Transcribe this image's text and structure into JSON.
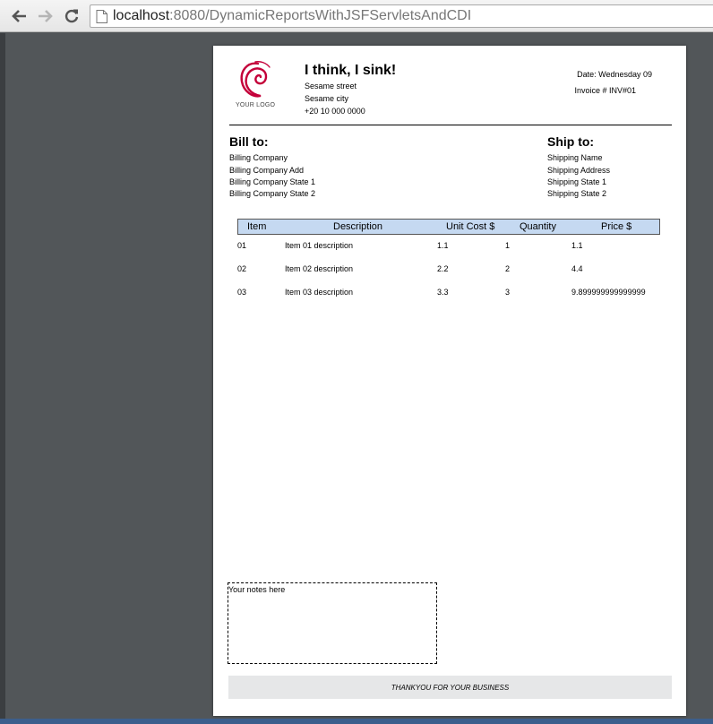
{
  "browser": {
    "url_host": "localhost",
    "url_rest": ":8080/DynamicReportsWithJSFServletsAndCDI"
  },
  "report": {
    "logo_text": "YOUR LOGO",
    "company": {
      "name": "I think, I sink!",
      "street": "Sesame street",
      "city": "Sesame city",
      "phone": "+20 10 000 0000"
    },
    "date_line": "Date: Wednesday 09",
    "invoice_line": "Invoice # INV#01",
    "bill_to": {
      "title": "Bill to:",
      "lines": [
        "Billing Company",
        "Billing Company Add",
        "Billing Company State 1",
        "Billing Company State 2"
      ]
    },
    "ship_to": {
      "title": "Ship to:",
      "lines": [
        "Shipping Name",
        "Shipping Address",
        "Shipping State 1",
        "Shipping State 2"
      ]
    },
    "table": {
      "headers": [
        "Item",
        "Description",
        "Unit Cost $",
        "Quantity",
        "Price $"
      ],
      "rows": [
        [
          "01",
          "Item 01 description",
          "1.1",
          "1",
          "1.1"
        ],
        [
          "02",
          "Item 02 description",
          "2.2",
          "2",
          "4.4"
        ],
        [
          "03",
          "Item 03 description",
          "3.3",
          "3",
          "9.899999999999999"
        ]
      ]
    },
    "notes": "Your notes here",
    "footer": "THANKYOU FOR YOUR BUSINESS"
  },
  "colors": {
    "header_fill": "#c5d9f1",
    "footer_fill": "#e6e7e8",
    "logo": "#c4003a",
    "viewer_bg": "#525659"
  },
  "icons": [
    "back-arrow-icon",
    "forward-arrow-icon",
    "reload-icon",
    "page-icon",
    "debian-swirl-icon"
  ]
}
